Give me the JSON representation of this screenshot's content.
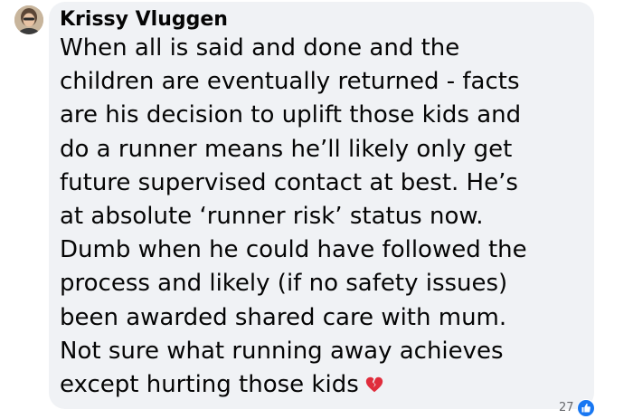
{
  "comment": {
    "author": "Krissy Vluggen",
    "lines": [
      "When all is said and done and the",
      "children are eventually returned - facts",
      "are his decision to uplift those kids and",
      "do a runner means he’ll likely only get",
      "future supervised contact at best. He’s",
      "at absolute ‘runner risk’ status now.",
      "Dumb when he could have followed the",
      "process and likely (if no safety issues)",
      "been awarded shared care with mum.",
      "Not sure what running away achieves",
      "except hurting those kids"
    ],
    "emoji": "broken-heart-icon",
    "reactions": {
      "count": "27",
      "icon": "like-icon",
      "color": "#1877f2"
    }
  },
  "colors": {
    "bubble": "#f0f2f5",
    "text": "#050505",
    "muted": "#65676b",
    "emoji": "#e02d3c"
  }
}
